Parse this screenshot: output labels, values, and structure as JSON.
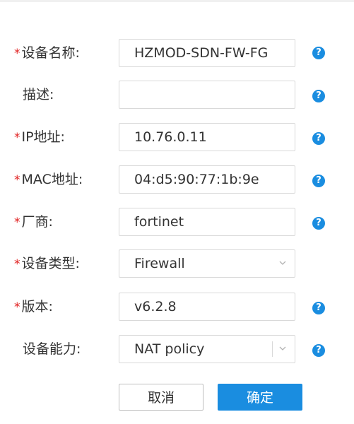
{
  "form": {
    "fields": [
      {
        "label": "设备名称:",
        "required": true,
        "value": "HZMOD-SDN-FW-FG",
        "placeholder": "",
        "type": "text"
      },
      {
        "label": "描述:",
        "required": false,
        "value": "",
        "placeholder": "",
        "type": "text"
      },
      {
        "label": "IP地址:",
        "required": true,
        "value": "10.76.0.11",
        "placeholder": "",
        "type": "text"
      },
      {
        "label": "MAC地址:",
        "required": true,
        "value": "04:d5:90:77:1b:9e",
        "placeholder": "",
        "type": "text"
      },
      {
        "label": "厂商:",
        "required": true,
        "value": "fortinet",
        "placeholder": "",
        "type": "text"
      },
      {
        "label": "设备类型:",
        "required": true,
        "value": "Firewall",
        "placeholder": "",
        "type": "select"
      },
      {
        "label": "版本:",
        "required": true,
        "value": "v6.2.8",
        "placeholder": "",
        "type": "text"
      },
      {
        "label": "设备能力:",
        "required": false,
        "value": "NAT policy",
        "placeholder": "",
        "type": "multiselect"
      }
    ],
    "required_marker": "*",
    "help_icon": "question-circle-icon",
    "help_glyph": "?"
  },
  "buttons": {
    "cancel_label": "取消",
    "confirm_label": "确定"
  },
  "colors": {
    "accent": "#1a8de0",
    "required": "#e02020",
    "border": "#d9d9d9",
    "text": "#333333"
  }
}
